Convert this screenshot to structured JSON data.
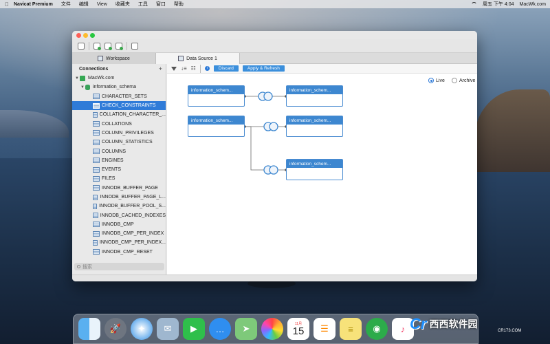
{
  "menubar": {
    "app_name": "Navicat Premium",
    "items": [
      "文件",
      "编辑",
      "View",
      "收藏夹",
      "工具",
      "窗口",
      "帮助"
    ],
    "clock": "周五 下午 4:04",
    "hostname": "MacWk.com"
  },
  "tabs": [
    {
      "label": "Workspace",
      "active": false
    },
    {
      "label": "Data Source 1",
      "active": true
    }
  ],
  "sidebar": {
    "title": "Connections",
    "add_label": "+",
    "connection": "MacWk.com",
    "schema": "information_schema",
    "tables": [
      "CHARACTER_SETS",
      "CHECK_CONSTRAINTS",
      "COLLATION_CHARACTER_...",
      "COLLATIONS",
      "COLUMN_PRIVILEGES",
      "COLUMN_STATISTICS",
      "COLUMNS",
      "ENGINES",
      "EVENTS",
      "FILES",
      "INNODB_BUFFER_PAGE",
      "INNODB_BUFFER_PAGE_L...",
      "INNODB_BUFFER_POOL_S...",
      "INNODB_CACHED_INDEXES",
      "INNODB_CMP",
      "INNODB_CMP_PER_INDEX",
      "INNODB_CMP_PER_INDEX...",
      "INNODB_CMP_RESET"
    ],
    "selected_table": "CHECK_CONSTRAINTS",
    "search_placeholder": "搜索"
  },
  "main": {
    "discard_label": "Discard",
    "apply_label": "Apply & Refresh",
    "mode_live": "Live",
    "mode_archive": "Archive",
    "mode_selected": "Live",
    "nodes": [
      "information_schem...",
      "information_schem...",
      "information_schem...",
      "information_schem...",
      "information_schem..."
    ]
  },
  "dock": {
    "calendar_month": "11月",
    "calendar_day": "15"
  },
  "watermark": {
    "logo": "Cr",
    "text": "西西软件园",
    "sub": "CR173.COM"
  },
  "colors": {
    "accent": "#2f7bd8",
    "node_header": "#3d87d0",
    "button": "#3b8fdc"
  }
}
